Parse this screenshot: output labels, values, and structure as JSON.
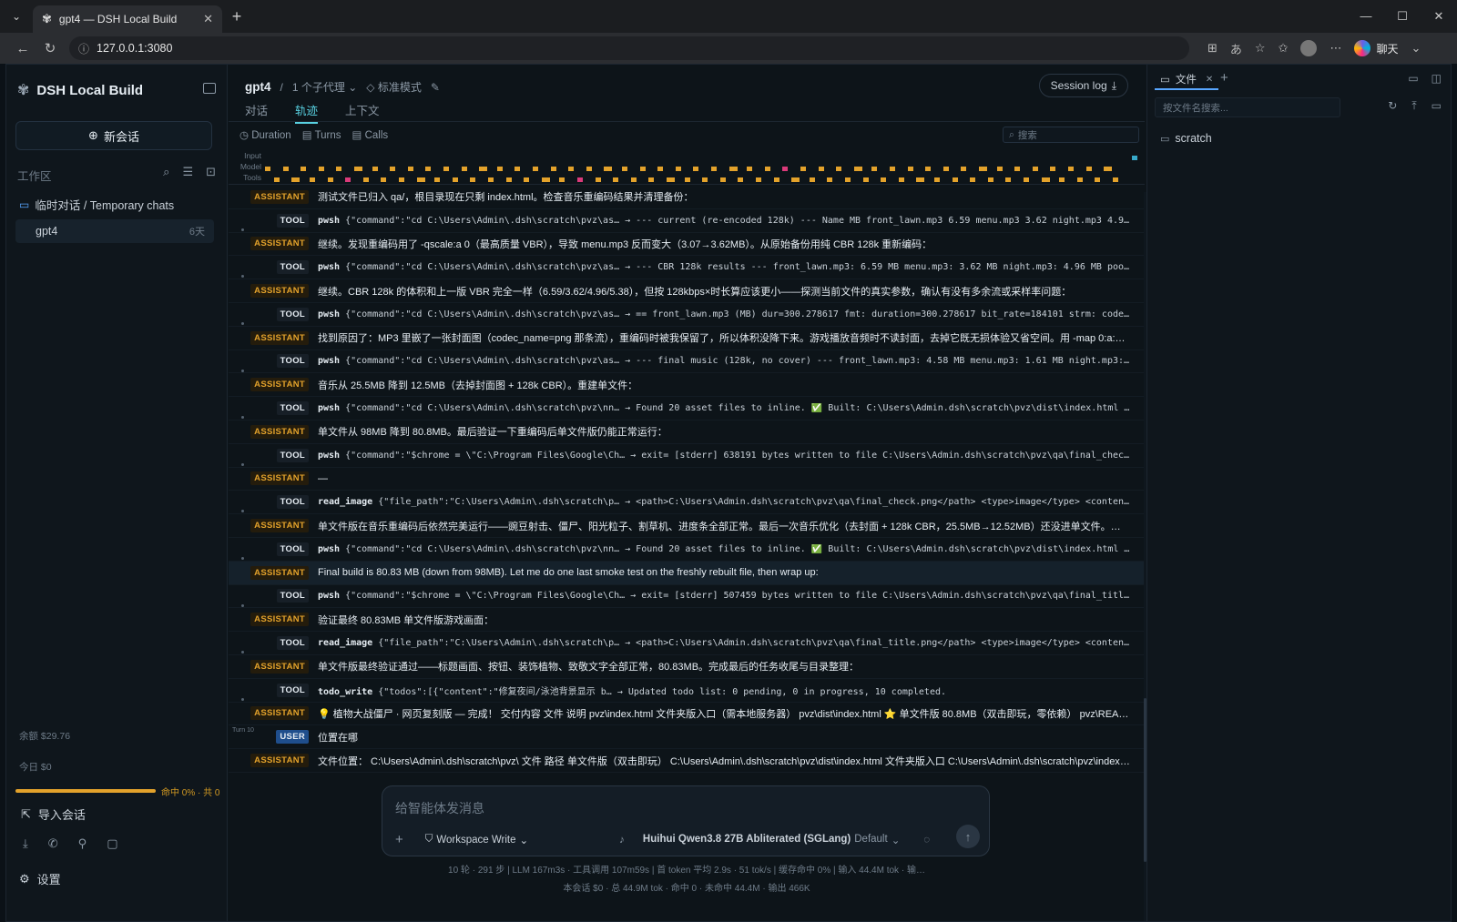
{
  "browser": {
    "tab_title": "gpt4 — DSH Local Build",
    "url": "127.0.0.1:3080",
    "copilot_label": "聊天"
  },
  "sidebar": {
    "brand": "DSH Local Build",
    "new_chat": "新会话",
    "workspace_label": "工作区",
    "folder": "临时对话 / Temporary chats",
    "chat_item": {
      "title": "gpt4",
      "age": "6天"
    },
    "balance": "余额 $29.76",
    "today": "今日 $0",
    "cache_hit": {
      "label": "命中 0% · 共 0",
      "fraction": 1.0
    },
    "import": "导入会话",
    "settings": "设置"
  },
  "header": {
    "title": "gpt4",
    "separator": "/",
    "subagents": "1 个子代理",
    "mode": "标准模式",
    "session_log": "Session log"
  },
  "tabs": [
    {
      "label": "对话",
      "active": false
    },
    {
      "label": "轨迹",
      "active": true
    },
    {
      "label": "上下文",
      "active": false
    }
  ],
  "filters": {
    "duration": "Duration",
    "turns": "Turns",
    "calls": "Calls",
    "search_placeholder": "搜索"
  },
  "timeline": {
    "labels": [
      "Input",
      "Model",
      "Tools"
    ],
    "colors": {
      "model": "#e3a22b",
      "alt": "#db3a7a",
      "input": "#37a9c9"
    }
  },
  "rows": [
    {
      "type": "ASSISTANT",
      "text": "测试文件已归入 qa/，根目录现在只剩 index.html。检查音乐重编码结果并清理备份："
    },
    {
      "type": "TOOL",
      "fn": "pwsh",
      "text": "{\"command\":\"cd C:\\Users\\Admin\\.dsh\\scratch\\pvz\\as… → --- current (re-encoded 128k) --- Name MB front_lawn.mp3 6.59 menu.mp3 3.62 night.mp3 4.96 pool.m…"
    },
    {
      "type": "ASSISTANT",
      "text": "继续。发现重编码用了 -qscale:a 0（最高质量 VBR），导致 menu.mp3 反而变大（3.07→3.62MB）。从原始备份用纯 CBR 128k 重新编码："
    },
    {
      "type": "TOOL",
      "fn": "pwsh",
      "text": "{\"command\":\"cd C:\\Users\\Admin\\.dsh\\scratch\\pvz\\as… → --- CBR 128k results --- front_lawn.mp3: 6.59 MB menu.mp3: 3.62 MB night.mp3: 4.96 MB pool.mp3: 5…"
    },
    {
      "type": "ASSISTANT",
      "text": "继续。CBR 128k 的体积和上一版 VBR 完全一样（6.59/3.62/4.96/5.38），但按 128kbps×时长算应该更小——探测当前文件的真实参数，确认有没有多余流或采样率问题："
    },
    {
      "type": "TOOL",
      "fn": "pwsh",
      "text": "{\"command\":\"cd C:\\Users\\Admin\\.dsh\\scratch\\pvz\\as… → == front_lawn.mp3 (MB) dur=300.278617 fmt: duration=300.278617 bit_rate=184101 strm: codec_name=m…"
    },
    {
      "type": "ASSISTANT",
      "text": "找到原因了：MP3 里嵌了一张封面图（codec_name=png 那条流），重编码时被我保留了，所以体积没降下来。游戏播放音频时不读封面，去掉它既无损体验又省空间。用 -map 0:a:0 只保留音频…"
    },
    {
      "type": "TOOL",
      "fn": "pwsh",
      "text": "{\"command\":\"cd C:\\Users\\Admin\\.dsh\\scratch\\pvz\\as… → --- final music (128k, no cover) --- front_lawn.mp3: 4.58 MB menu.mp3: 1.61 MB night.mp3: 2.95 MB…"
    },
    {
      "type": "ASSISTANT",
      "text": "音乐从 25.5MB 降到 12.5MB（去掉封面图 + 128k CBR）。重建单文件："
    },
    {
      "type": "TOOL",
      "fn": "pwsh",
      "text": "{\"command\":\"cd C:\\Users\\Admin\\.dsh\\scratch\\pvz\\nn… → Found 20 asset files to inline. ✅ Built: C:\\Users\\Admin.dsh\\scratch\\pvz\\dist\\index.html (80.83 …"
    },
    {
      "type": "ASSISTANT",
      "text": "单文件从 98MB 降到 80.8MB。最后验证一下重编码后单文件版仍能正常运行："
    },
    {
      "type": "TOOL",
      "fn": "pwsh",
      "text": "{\"command\":\"$chrome = \\\"C:\\Program Files\\Google\\Ch… → exit= [stderr] 638191 bytes written to file C:\\Users\\Admin.dsh\\scratch\\pvz\\qa\\final_check.png"
    },
    {
      "type": "ASSISTANT",
      "text": "—"
    },
    {
      "type": "TOOL",
      "fn": "read_image",
      "text": "{\"file_path\":\"C:\\Users\\Admin\\.dsh\\scratch\\p… → <path>C:\\Users\\Admin.dsh\\scratch\\pvz\\qa\\final_check.png</path> <type>image</type> <content> image…"
    },
    {
      "type": "ASSISTANT",
      "text": "单文件版在音乐重编码后依然完美运行——豌豆射击、僵尸、阳光粒子、割草机、进度条全部正常。最后一次音乐优化（去封面 + 128k CBR，25.5MB→12.52MB）还没进单文件。重建一次拿到最…"
    },
    {
      "type": "TOOL",
      "fn": "pwsh",
      "text": "{\"command\":\"cd C:\\Users\\Admin\\.dsh\\scratch\\pvz\\nn… → Found 20 asset files to inline. ✅ Built: C:\\Users\\Admin.dsh\\scratch\\pvz\\dist\\index.html (80.83 …"
    },
    {
      "type": "ASSISTANT",
      "text": "Final build is 80.83 MB (down from 98MB). Let me do one last smoke test on the freshly rebuilt file, then wrap up:",
      "highlight": true
    },
    {
      "type": "TOOL",
      "fn": "pwsh",
      "text": "{\"command\":\"$chrome = \\\"C:\\Program Files\\Google\\Ch… → exit= [stderr] 507459 bytes written to file C:\\Users\\Admin.dsh\\scratch\\pvz\\qa\\final_title.png"
    },
    {
      "type": "ASSISTANT",
      "text": "验证最终 80.83MB 单文件版游戏画面："
    },
    {
      "type": "TOOL",
      "fn": "read_image",
      "text": "{\"file_path\":\"C:\\Users\\Admin\\.dsh\\scratch\\p… → <path>C:\\Users\\Admin.dsh\\scratch\\pvz\\qa\\final_title.png</path> <type>image</type> <content> image…"
    },
    {
      "type": "ASSISTANT",
      "text": "单文件版最终验证通过——标题画面、按钮、装饰植物、致敬文字全部正常，80.83MB。完成最后的任务收尾与目录整理："
    },
    {
      "type": "TOOL",
      "fn": "todo_write",
      "text": "{\"todos\":[{\"content\":\"修复夜间/泳池背景显示 b… → Updated todo list: 0 pending, 0 in progress, 10 completed."
    },
    {
      "type": "ASSISTANT",
      "text": "💡 植物大战僵尸 · 网页复刻版 — 完成！ 交付内容 文件 说明 pvz\\index.html 文件夹版入口（需本地服务器） pvz\\dist\\index.html ⭐ 单文件版 80.8MB（双击即玩，零依赖） pvz\\README.md 完…"
    },
    {
      "type": "USER",
      "text": "位置在哪",
      "turn": "Turn 10"
    },
    {
      "type": "ASSISTANT",
      "text": "文件位置： C:\\Users\\Admin\\.dsh\\scratch\\pvz\\ 文件 路径 单文件版（双击即玩） C:\\Users\\Admin\\.dsh\\scratch\\pvz\\dist\\index.html 文件夹版入口 C:\\Users\\Admin\\.dsh\\scratch\\pvz\\index.html READ…"
    }
  ],
  "composer": {
    "placeholder": "给智能体发消息",
    "mode": "Workspace Write",
    "model": "Huihui Qwen3.8 27B Abliterated (SGLang)",
    "model_variant": "Default"
  },
  "stats": {
    "line1": "10 轮 · 291 步  |  LLM 167m3s · 工具调用 107m59s  |  首 token 平均 2.9s · 51 tok/s  |  缓存命中 0%  |  输入 44.4M tok · 输…",
    "line2": "本会话 $0 · 总 44.9M tok · 命中 0 · 未命中 44.4M · 输出 466K"
  },
  "files_panel": {
    "tab": "文件",
    "search_placeholder": "按文件名搜索...",
    "items": [
      "scratch"
    ]
  }
}
